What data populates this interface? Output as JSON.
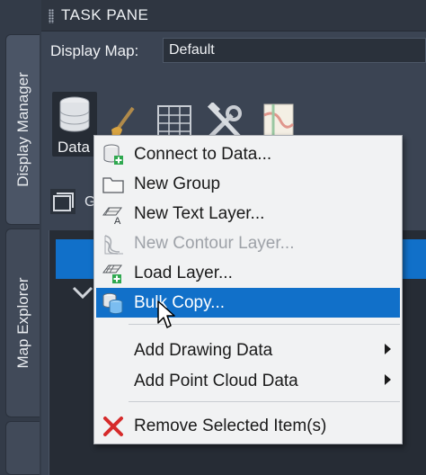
{
  "title_bar": {
    "title": "TASK PANE"
  },
  "side_tabs": [
    {
      "label": "Display Manager",
      "active": true
    },
    {
      "label": "Map Explorer",
      "active": false
    }
  ],
  "display_map": {
    "label": "Display Map:",
    "value": "Default"
  },
  "toolbar": {
    "data_label": "Data",
    "buttons": [
      "database-icon",
      "brush-icon",
      "table-icon",
      "tools-icon",
      "map-icon"
    ]
  },
  "row2": {
    "text": "G"
  },
  "context_menu": {
    "items": [
      {
        "label": "Connect to Data...",
        "icon": "connect-data-icon",
        "disabled": false,
        "submenu": false
      },
      {
        "label": "New Group",
        "icon": "folder-icon",
        "disabled": false,
        "submenu": false
      },
      {
        "label": "New Text Layer...",
        "icon": "text-layer-icon",
        "disabled": false,
        "submenu": false
      },
      {
        "label": "New Contour Layer...",
        "icon": "contour-layer-icon",
        "disabled": true,
        "submenu": false
      },
      {
        "label": "Load Layer...",
        "icon": "load-layer-icon",
        "disabled": false,
        "submenu": false
      },
      {
        "label": "Bulk Copy...",
        "icon": "bulk-copy-icon",
        "disabled": false,
        "submenu": false,
        "highlighted": true
      },
      {
        "label": "Add Drawing Data",
        "icon": "",
        "disabled": false,
        "submenu": true
      },
      {
        "label": "Add Point Cloud Data",
        "icon": "",
        "disabled": false,
        "submenu": true
      },
      {
        "label": "Remove Selected Item(s)",
        "icon": "red-x-icon",
        "disabled": false,
        "submenu": false
      }
    ]
  },
  "colors": {
    "highlight": "#1170c9",
    "panel_bg": "#3b4453",
    "menu_bg": "#f1f2f3",
    "remove_red": "#d62b2b",
    "add_green": "#2fa84f"
  }
}
